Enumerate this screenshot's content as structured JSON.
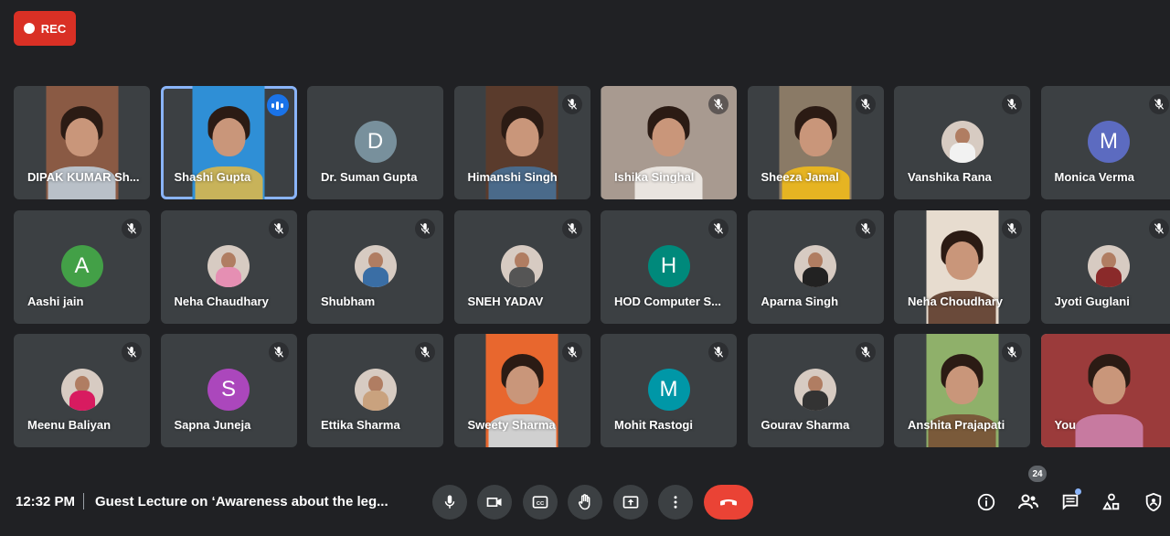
{
  "recording": {
    "label": "REC"
  },
  "participants": [
    {
      "name": "DIPAK KUMAR Sh...",
      "type": "video",
      "muted": false,
      "body": "#b9c0c8",
      "bg": "#8a5a44"
    },
    {
      "name": "Shashi Gupta",
      "type": "video",
      "muted": false,
      "speaking": true,
      "active": true,
      "body": "#c8b35a",
      "bg": "#2f8fd6"
    },
    {
      "name": "Dr. Suman Gupta",
      "type": "letter",
      "letter": "D",
      "color": "#78909c",
      "muted": false
    },
    {
      "name": "Himanshi Singh",
      "type": "video",
      "muted": true,
      "body": "#4a6a8a",
      "bg": "#5a3b2c"
    },
    {
      "name": "Ishika Singhal",
      "type": "video",
      "muted": true,
      "wide": true,
      "body": "#e9e4df",
      "bg": "#a89a90"
    },
    {
      "name": "Sheeza Jamal",
      "type": "video",
      "muted": true,
      "body": "#e6b422",
      "bg": "#8a7a66"
    },
    {
      "name": "Vanshika Rana",
      "type": "photo",
      "body": "#f2f2f2",
      "muted": true
    },
    {
      "name": "Monica Verma",
      "type": "letter",
      "letter": "M",
      "color": "#5c6bc0",
      "muted": true
    },
    {
      "name": "Aashi jain",
      "type": "letter",
      "letter": "A",
      "color": "#43a047",
      "muted": true
    },
    {
      "name": "Neha Chaudhary",
      "type": "photo",
      "body": "#e58fb3",
      "muted": true
    },
    {
      "name": "Shubham",
      "type": "photo",
      "body": "#3a6ea5",
      "muted": true
    },
    {
      "name": "SNEH YADAV",
      "type": "photo",
      "body": "#555555",
      "muted": true
    },
    {
      "name": "HOD Computer S...",
      "type": "letter",
      "letter": "H",
      "color": "#00897b",
      "muted": true
    },
    {
      "name": "Aparna Singh",
      "type": "photo",
      "body": "#222222",
      "muted": true
    },
    {
      "name": "Neha Choudhary",
      "type": "video",
      "muted": true,
      "wide": false,
      "body": "#6a4a3a",
      "bg": "#e7dccf"
    },
    {
      "name": "Jyoti Guglani",
      "type": "photo",
      "body": "#8a2a2a",
      "muted": true
    },
    {
      "name": "Meenu Baliyan",
      "type": "photo",
      "body": "#d81b60",
      "muted": true
    },
    {
      "name": "Sapna Juneja",
      "type": "letter",
      "letter": "S",
      "color": "#ab47bc",
      "muted": true
    },
    {
      "name": "Ettika Sharma",
      "type": "photo",
      "body": "#c9a27e",
      "muted": true
    },
    {
      "name": "Sweety Sharma",
      "type": "video",
      "muted": true,
      "body": "#d0d0d0",
      "bg": "#e8672e"
    },
    {
      "name": "Mohit Rastogi",
      "type": "letter",
      "letter": "M",
      "color": "#0097a7",
      "muted": true
    },
    {
      "name": "Gourav Sharma",
      "type": "photo",
      "body": "#333333",
      "muted": true
    },
    {
      "name": "Anshita Prajapati",
      "type": "video",
      "muted": true,
      "body": "#7a5a3a",
      "bg": "#8fb06a"
    },
    {
      "name": "You",
      "type": "video",
      "muted": false,
      "self": true,
      "wide": true,
      "body": "#c77aa0",
      "bg": "#9b3b3b"
    }
  ],
  "bottom_bar": {
    "time": "12:32 PM",
    "meeting_title": "Guest Lecture on ‘Awareness about the leg...",
    "participant_count": "24"
  },
  "colors": {
    "background": "#202124",
    "tile": "#3c4043",
    "hangup": "#ea4335",
    "rec": "#d93025",
    "accent": "#8ab4f8"
  },
  "icons": {
    "controls": [
      "mic-icon",
      "camera-icon",
      "captions-icon",
      "raise-hand-icon",
      "present-icon",
      "more-options-icon",
      "end-call-icon"
    ],
    "right": [
      "info-icon",
      "people-icon",
      "chat-icon",
      "activities-icon",
      "host-controls-icon"
    ]
  }
}
